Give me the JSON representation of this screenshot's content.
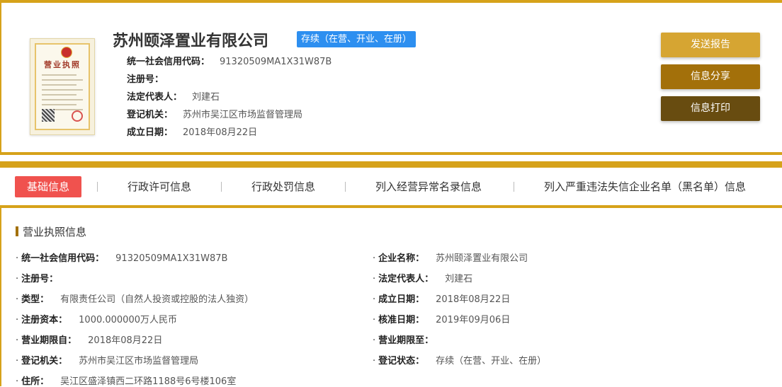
{
  "header": {
    "company_name": "苏州颐泽置业有限公司",
    "status_badge": "存续（在营、开业、在册）",
    "license_image_title": "营业执照",
    "info": [
      {
        "label": "统一社会信用代码：",
        "value": "91320509MA1X31W87B"
      },
      {
        "label": "注册号：",
        "value": ""
      },
      {
        "label": "法定代表人：",
        "value": "刘建石"
      },
      {
        "label": "登记机关：",
        "value": "苏州市吴江区市场监督管理局"
      },
      {
        "label": "成立日期：",
        "value": "2018年08月22日"
      }
    ]
  },
  "actions": {
    "send_report": "发送报告",
    "share_info": "信息分享",
    "print_info": "信息打印"
  },
  "tabs": [
    {
      "label": "基础信息",
      "active": true
    },
    {
      "label": "行政许可信息",
      "active": false
    },
    {
      "label": "行政处罚信息",
      "active": false
    },
    {
      "label": "列入经营异常名录信息",
      "active": false
    },
    {
      "label": "列入严重违法失信企业名单（黑名单）信息",
      "active": false
    }
  ],
  "section": {
    "title": "营业执照信息",
    "left": [
      {
        "label": "统一社会信用代码：",
        "value": "91320509MA1X31W87B"
      },
      {
        "label": "注册号：",
        "value": ""
      },
      {
        "label": "类型：",
        "value": "有限责任公司（自然人投资或控股的法人独资）"
      },
      {
        "label": "注册资本：",
        "value": "1000.000000万人民币"
      },
      {
        "label": "营业期限自：",
        "value": "2018年08月22日"
      },
      {
        "label": "登记机关：",
        "value": "苏州市吴江区市场监督管理局"
      },
      {
        "label": "住所：",
        "value": "吴江区盛泽镇西二环路1188号6号楼106室"
      }
    ],
    "right": [
      {
        "label": "企业名称：",
        "value": "苏州颐泽置业有限公司"
      },
      {
        "label": "法定代表人：",
        "value": "刘建石"
      },
      {
        "label": "成立日期：",
        "value": "2018年08月22日"
      },
      {
        "label": "核准日期：",
        "value": "2019年09月06日"
      },
      {
        "label": "营业期限至：",
        "value": ""
      },
      {
        "label": "登记状态：",
        "value": "存续（在营、开业、在册）"
      }
    ]
  },
  "colors": {
    "accent_gold": "#d6a21a",
    "active_tab": "#f0524e",
    "badge_blue": "#2d8ff0"
  }
}
